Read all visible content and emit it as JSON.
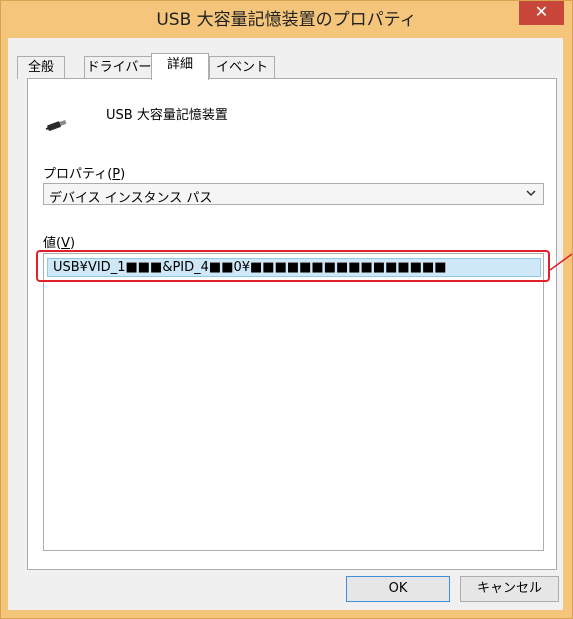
{
  "window": {
    "title": "USB 大容量記憶装置のプロパティ",
    "close_symbol": "✕"
  },
  "tabs": [
    {
      "label": "全般",
      "active": false
    },
    {
      "label": "ドライバー",
      "active": false
    },
    {
      "label": "詳細",
      "active": true
    },
    {
      "label": "イベント",
      "active": false
    }
  ],
  "device": {
    "name": "USB 大容量記憶装置",
    "icon": "usb-plug-icon"
  },
  "property": {
    "label_prefix": "プロパティ(",
    "label_accel": "P",
    "label_suffix": ")",
    "selected": "デバイス インスタンス パス"
  },
  "value": {
    "label_prefix": "値(",
    "label_accel": "V",
    "label_suffix": ")",
    "items": [
      "USB¥VID_1■■■&PID_4■■0¥■■■■■■■■■■■■■■■■"
    ]
  },
  "buttons": {
    "ok": "OK",
    "cancel": "キャンセル"
  },
  "colors": {
    "window_frame": "#f4c57a",
    "close_button": "#c8463a",
    "selection": "#cfe8f7",
    "annotation": "#e0202a"
  }
}
